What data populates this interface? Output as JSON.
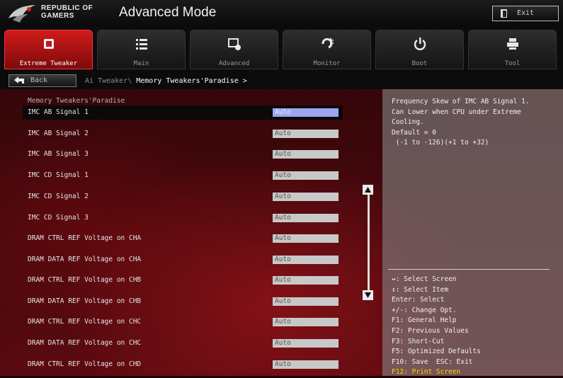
{
  "header": {
    "brand_line1": "REPUBLIC OF",
    "brand_line2": "GAMERS",
    "mode_title": "Advanced Mode",
    "exit_label": "Exit"
  },
  "tabs": [
    {
      "label": "Extreme Tweaker",
      "icon": "extreme-tweaker-icon",
      "active": true
    },
    {
      "label": "Main",
      "icon": "main-list-icon",
      "active": false
    },
    {
      "label": "Advanced",
      "icon": "advanced-chip-icon",
      "active": false
    },
    {
      "label": "Monitor",
      "icon": "monitor-fan-icon",
      "active": false
    },
    {
      "label": "Boot",
      "icon": "power-icon",
      "active": false
    },
    {
      "label": "Tool",
      "icon": "tool-printer-icon",
      "active": false
    }
  ],
  "breadcrumb": {
    "back_label": "Back",
    "path_prefix": "Ai Tweaker\\ ",
    "current": "Memory Tweakers'Paradise >"
  },
  "section_title": "Memory Tweakers'Paradise",
  "settings": [
    {
      "label": "IMC AB Signal 1",
      "value": "Auto",
      "selected": true
    },
    {
      "label": "IMC AB Signal 2",
      "value": "Auto"
    },
    {
      "label": "IMC AB Signal 3",
      "value": "Auto"
    },
    {
      "label": "IMC CD Signal 1",
      "value": "Auto"
    },
    {
      "label": "IMC CD Signal 2",
      "value": "Auto"
    },
    {
      "label": "IMC CD Signal 3",
      "value": "Auto"
    },
    {
      "label": "DRAM CTRL REF Voltage on CHA",
      "value": "Auto"
    },
    {
      "label": "DRAM DATA REF Voltage on CHA",
      "value": "Auto"
    },
    {
      "label": "DRAM CTRL REF Voltage on CHB",
      "value": "Auto"
    },
    {
      "label": "DRAM DATA REF Voltage on CHB",
      "value": "Auto"
    },
    {
      "label": "DRAM CTRL REF Voltage on CHC",
      "value": "Auto"
    },
    {
      "label": "DRAM DATA REF Voltage on CHC",
      "value": "Auto"
    },
    {
      "label": "DRAM CTRL REF Voltage on CHD",
      "value": "Auto"
    }
  ],
  "help": {
    "lines": [
      "Frequency Skew of IMC AB Signal 1.",
      "Can Lower when CPU under Extreme",
      "Cooling.",
      "Default = 0",
      " (-1 to -126)(+1 to +32)"
    ]
  },
  "keys": [
    "↔: Select Screen",
    "↕: Select Item",
    "Enter: Select",
    "+/-: Change Opt.",
    "F1: General Help",
    "F2: Previous Values",
    "F3: Short-Cut",
    "F5: Optimized Defaults",
    "F10: Save  ESC: Exit",
    "F12: Print Screen"
  ],
  "colors": {
    "active_tab": "#c4161c",
    "selected_value": "#9ca6ef",
    "highlight_key": "#ffd400"
  }
}
